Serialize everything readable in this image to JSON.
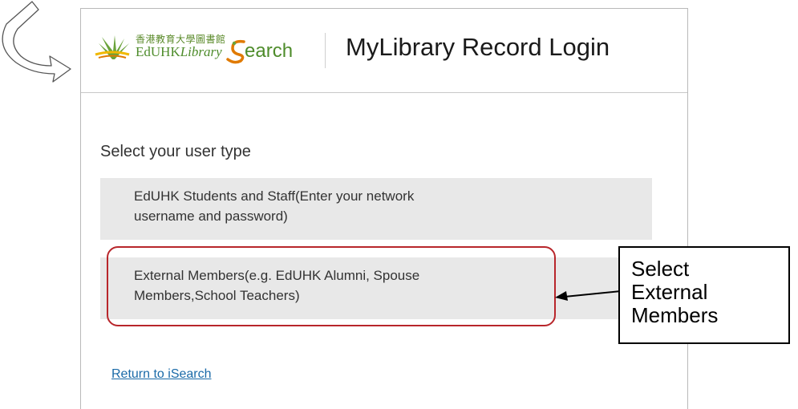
{
  "header": {
    "logo_chinese": "香港教育大學圖書館",
    "logo_edu": "EdUHK",
    "logo_library": "Library",
    "logo_search": "earch",
    "title": "MyLibrary Record Login"
  },
  "form": {
    "prompt": "Select your user type",
    "options": [
      {
        "label_line1": "EdUHK Students and Staff(Enter your network",
        "label_line2": "username and password)"
      },
      {
        "label_line1": "External Members(e.g. EdUHK Alumni, Spouse",
        "label_line2": "Members,School Teachers)"
      }
    ],
    "return_link": "Return to iSearch"
  },
  "annotation": {
    "callout_lines": [
      "Select",
      "External",
      "Members"
    ],
    "highlight_color": "#b8262b"
  },
  "icons": {
    "back_arrow": "curved-back-arrow-icon",
    "logo_leaf": "leaf-logo-icon",
    "logo_s": "swirl-s-logo-icon",
    "pointer": "pointer-arrow-icon"
  },
  "colors": {
    "brand_green": "#4e8c2b",
    "link_blue": "#1a6aa8",
    "option_bg": "#e8e8e8"
  }
}
